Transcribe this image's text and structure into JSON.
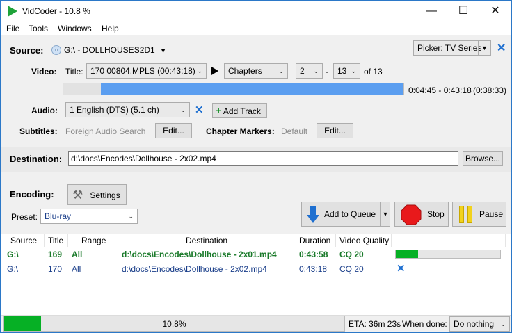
{
  "window": {
    "title": "VidCoder - 10.8 %",
    "minimize": "—",
    "maximize": "☐",
    "close": "✕"
  },
  "menu": [
    "File",
    "Tools",
    "Windows",
    "Help"
  ],
  "source": {
    "label": "Source:",
    "drive": "G:\\ - DOLLHOUSES2D1",
    "picker": "Picker: TV Series",
    "video_label": "Video:",
    "title_label": "Title:",
    "title_value": "170 00804.MPLS (00:43:18)",
    "range_type": "Chapters",
    "range_start": "2",
    "range_dash": "-",
    "range_end": "13",
    "range_of": "of 13",
    "timeline_time": "0:04:45 - 0:43:18",
    "timeline_duration": "(0:38:33)",
    "timeline_start_fraction": 0.11,
    "audio_label": "Audio:",
    "audio_value": "1 English (DTS) (5.1 ch)",
    "add_track": "Add Track",
    "subtitles_label": "Subtitles:",
    "subtitles_value": "Foreign Audio Search",
    "edit_label": "Edit...",
    "chapter_markers_label": "Chapter Markers:",
    "chapter_markers_value": "Default",
    "edit2_label": "Edit..."
  },
  "destination": {
    "label": "Destination:",
    "path": "d:\\docs\\Encodes\\Dollhouse - 2x02.mp4",
    "browse": "Browse..."
  },
  "encoding": {
    "label": "Encoding:",
    "settings": "Settings",
    "preset_label": "Preset:",
    "preset_value": "Blu-ray",
    "add_to_queue": "Add to Queue",
    "stop": "Stop",
    "pause": "Pause"
  },
  "queue": {
    "headers": [
      "Source",
      "Title",
      "Range",
      "Destination",
      "Duration",
      "Video Quality"
    ],
    "rows": [
      {
        "source": "G:\\",
        "title": "169",
        "range": "All",
        "destination": "d:\\docs\\Encodes\\Dollhouse - 2x01.mp4",
        "duration": "0:43:58",
        "quality": "CQ 20",
        "progress": 0.21
      },
      {
        "source": "G:\\",
        "title": "170",
        "range": "All",
        "destination": "d:\\docs\\Encodes\\Dollhouse - 2x02.mp4",
        "duration": "0:43:18",
        "quality": "CQ 20"
      }
    ]
  },
  "status": {
    "progress_text": "10.8%",
    "progress": 0.108,
    "eta": "ETA: 36m 23s",
    "when_done_label": "When done:",
    "when_done_value": "Do nothing"
  },
  "colors": {
    "accent": "#5b9ef0",
    "progress": "#06b025",
    "active_row": "#1a7a2a",
    "queued_row": "#1b3f8a",
    "remove": "#1e6fd0"
  }
}
